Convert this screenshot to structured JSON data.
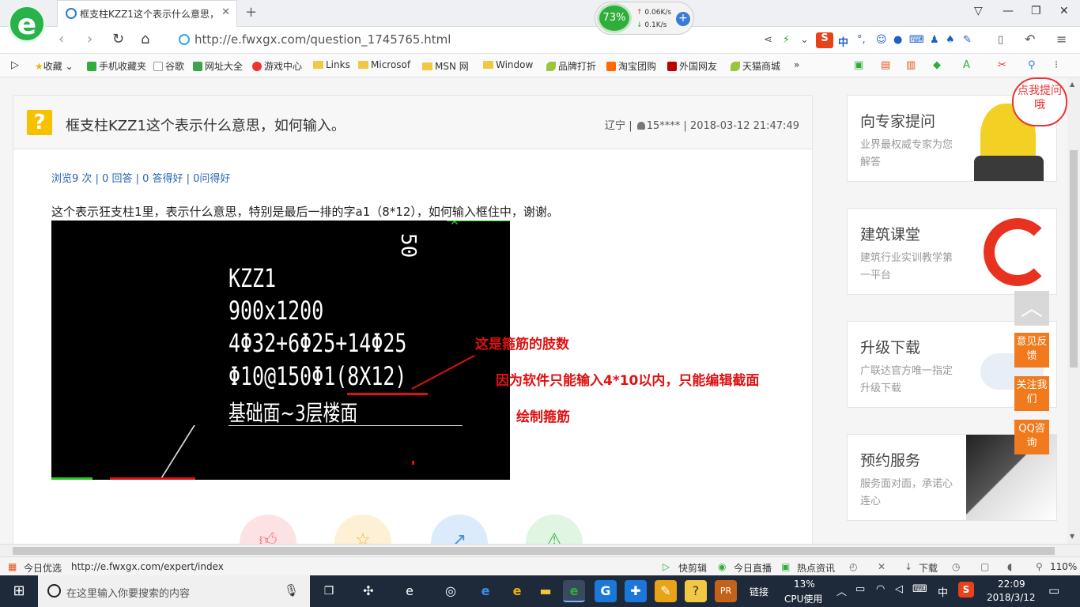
{
  "browser": {
    "tab_title": "框支柱KZZ1这个表示什么意思，",
    "tab_close": "✕",
    "new_tab": "+",
    "speed": {
      "percent": "73%",
      "up": "0.06K/s",
      "down": "0.1K/s"
    },
    "url": "http://e.fwxgx.com/question_1745765.html",
    "bookmarks": [
      "收藏",
      "手机收藏夹",
      "谷歌",
      "网址大全",
      "游戏中心",
      "Links",
      "Microsof",
      "MSN 网",
      "Window",
      "品牌打折",
      "淘宝团购",
      "外国网友",
      "天猫商城"
    ],
    "chevron": "»",
    "sogou": "中"
  },
  "question": {
    "title": "框支柱KZZ1这个表示什么意思，如何输入。",
    "location": "辽宁",
    "user": "15****",
    "datetime": "2018-03-12 21:47:49",
    "stats": "浏览9 次 | 0 回答 | 0 答得好 | 0问得好",
    "body": "这个表示狂支柱1里，表示什么意思，特别是最后一排的字a1（8*12），如何输入框住中，谢谢。"
  },
  "cad_image": {
    "corner_mark": "50",
    "line1": "KZZ1",
    "line2": "900x1200",
    "line3": "4Φ32+6Φ25+14Φ25",
    "line4": "Φ10@150Φ1(8X12)",
    "line5": "基础面~3层楼面",
    "annotation1": "这是箍筋的肢数",
    "annotation2": "因为软件只能输入4*10以内，只能编辑截面",
    "annotation3": "绘制箍筋"
  },
  "sidebar": {
    "ask_bubble": "点我提问哦",
    "cards": [
      {
        "title": "向专家提问",
        "desc": "业界最权威专家为您解答"
      },
      {
        "title": "建筑课堂",
        "desc": "建筑行业实训教学第一平台"
      },
      {
        "title": "升级下载",
        "desc": "广联达官方唯一指定升级下载"
      },
      {
        "title": "预约服务",
        "desc": "服务面对面，承诺心连心"
      }
    ],
    "float_buttons": [
      "意见反馈",
      "关注我们",
      "QQ咨询"
    ]
  },
  "statusbar": {
    "left_label": "今日优选",
    "link": "http://e.fwxgx.com/expert/index",
    "items": [
      "快剪辑",
      "今日直播",
      "热点资讯",
      "下载"
    ],
    "zoom": "110%"
  },
  "taskbar": {
    "search_placeholder": "在这里输入你要搜索的内容",
    "link_label": "链接",
    "cpu_percent": "13%",
    "cpu_label": "CPU使用",
    "ime": "中",
    "time": "22:09",
    "date": "2018/3/12"
  },
  "colors": {
    "accent_green": "#27b24a",
    "brand_orange": "#f07a1c",
    "annotation_red": "#e01010",
    "taskbar": "#1e2a3a"
  }
}
